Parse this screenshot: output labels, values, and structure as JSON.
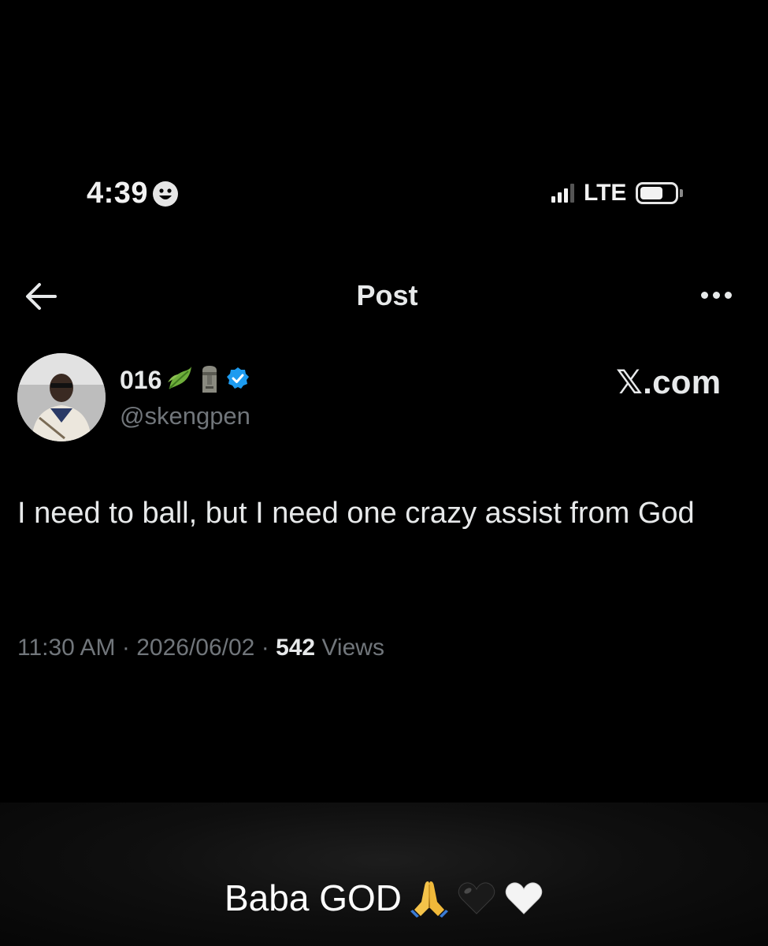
{
  "status_bar": {
    "time": "4:39",
    "network": "LTE",
    "icons": [
      "smiley-icon",
      "signal-icon",
      "battery-icon"
    ]
  },
  "header": {
    "title": "Post",
    "icons": [
      "back-arrow-icon",
      "more-options-icon"
    ]
  },
  "post": {
    "author_name": "016",
    "author_handle": "@skengpen",
    "name_emojis": [
      "leaf-emoji",
      "moai-emoji",
      "verified-badge-icon"
    ],
    "brand": "𝕏.com",
    "text": "I need to ball, but I need one crazy assist from God",
    "time": "11:30 AM",
    "date": "2026/06/02",
    "views_count": "542",
    "views_label": "Views",
    "separator": "·"
  },
  "caption": {
    "text": "Baba GOD",
    "emojis": [
      "praying-hands-emoji",
      "black-heart-emoji",
      "white-heart-emoji"
    ]
  },
  "colors": {
    "background": "#000000",
    "text_primary": "#e7e9ea",
    "text_secondary": "#71767b",
    "verified_blue": "#1d9bf0"
  }
}
